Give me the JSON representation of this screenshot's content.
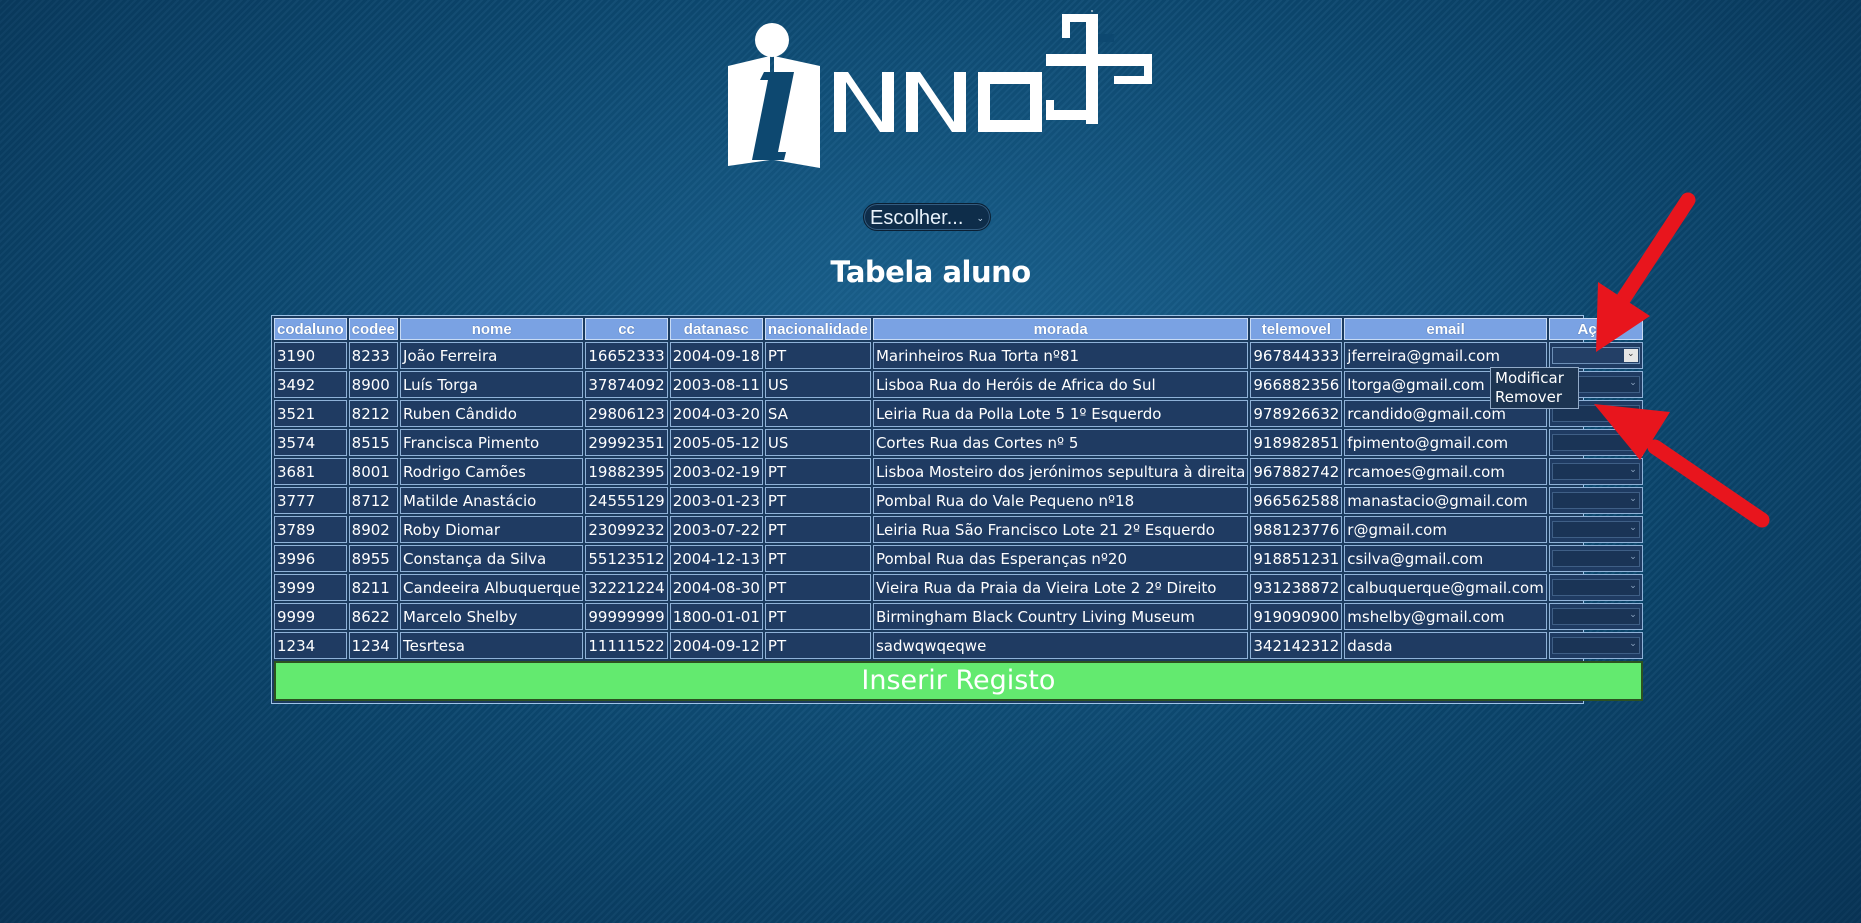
{
  "brand": {
    "logo_alt": "INNO+"
  },
  "chooser": {
    "label": "Escolher..."
  },
  "title": "Tabela aluno",
  "table": {
    "headers": [
      "codaluno",
      "codee",
      "nome",
      "cc",
      "datanasc",
      "nacionalidade",
      "morada",
      "telemovel",
      "email",
      "Ação"
    ],
    "rows": [
      [
        "3190",
        "8233",
        "João Ferreira",
        "16652333",
        "2004-09-18",
        "PT",
        "Marinheiros Rua Torta nº81",
        "967844333",
        "jferreira@gmail.com"
      ],
      [
        "3492",
        "8900",
        "Luís Torga",
        "37874092",
        "2003-08-11",
        "US",
        "Lisboa Rua do Heróis de Africa do Sul",
        "966882356",
        "ltorga@gmail.com"
      ],
      [
        "3521",
        "8212",
        "Ruben Cândido",
        "29806123",
        "2004-03-20",
        "SA",
        "Leiria Rua da Polla Lote 5 1º Esquerdo",
        "978926632",
        "rcandido@gmail.com"
      ],
      [
        "3574",
        "8515",
        "Francisca Pimento",
        "29992351",
        "2005-05-12",
        "US",
        "Cortes Rua das Cortes nº 5",
        "918982851",
        "fpimento@gmail.com"
      ],
      [
        "3681",
        "8001",
        "Rodrigo Camões",
        "19882395",
        "2003-02-19",
        "PT",
        "Lisboa Mosteiro dos jerónimos sepultura à direita",
        "967882742",
        "rcamoes@gmail.com"
      ],
      [
        "3777",
        "8712",
        "Matilde Anastácio",
        "24555129",
        "2003-01-23",
        "PT",
        "Pombal Rua do Vale Pequeno nº18",
        "966562588",
        "manastacio@gmail.com"
      ],
      [
        "3789",
        "8902",
        "Roby Diomar",
        "23099232",
        "2003-07-22",
        "PT",
        "Leiria Rua São Francisco Lote 21 2º Esquerdo",
        "988123776",
        "r@gmail.com"
      ],
      [
        "3996",
        "8955",
        "Constança da Silva",
        "55123512",
        "2004-12-13",
        "PT",
        "Pombal Rua das Esperanças nº20",
        "918851231",
        "csilva@gmail.com"
      ],
      [
        "3999",
        "8211",
        "Candeeira Albuquerque",
        "32221224",
        "2004-08-30",
        "PT",
        "Vieira Rua da Praia da Vieira Lote 2 2º Direito",
        "931238872",
        "calbuquerque@gmail.com"
      ],
      [
        "9999",
        "8622",
        "Marcelo Shelby",
        "99999999",
        "1800-01-01",
        "PT",
        "Birmingham Black Country Living Museum",
        "919090900",
        "mshelby@gmail.com"
      ],
      [
        "1234",
        "1234",
        "Tesrtesa",
        "11111522",
        "2004-09-12",
        "PT",
        "sadwqwqeqwe",
        "342142312",
        "dasda"
      ]
    ]
  },
  "action_options": [
    "Modificar",
    "Remover"
  ],
  "insert_button": {
    "label": "Inserir Registo"
  },
  "colors": {
    "header_bg": "#7aa2e3",
    "cell_bg": "#1f3b62",
    "insert_bg": "#63ea6f",
    "annotation_arrow": "#e8151d"
  }
}
